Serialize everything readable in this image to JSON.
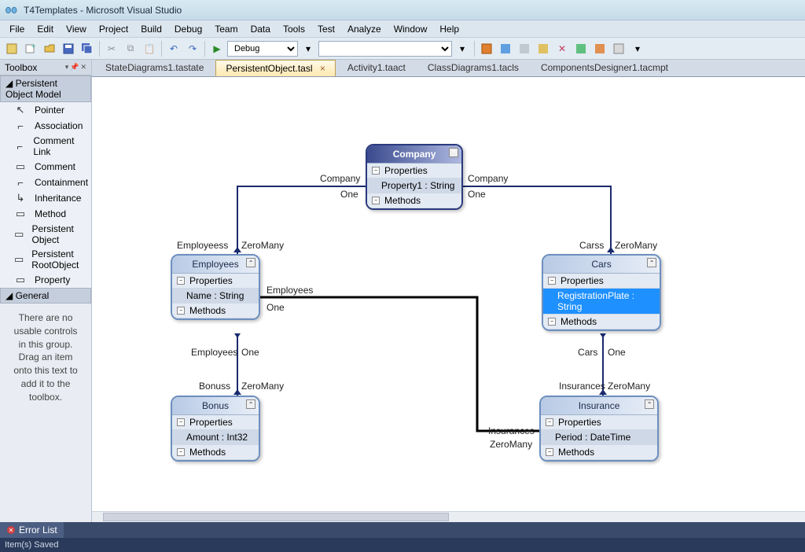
{
  "app": {
    "title": "T4Templates - Microsoft Visual Studio"
  },
  "menu": {
    "items": [
      "File",
      "Edit",
      "View",
      "Project",
      "Build",
      "Debug",
      "Team",
      "Data",
      "Tools",
      "Test",
      "Analyze",
      "Window",
      "Help"
    ]
  },
  "toolbar": {
    "config": "Debug"
  },
  "toolbox": {
    "title": "Toolbox",
    "section1": "Persistent Object Model",
    "items": [
      {
        "label": "Pointer",
        "icon": "↖"
      },
      {
        "label": "Association",
        "icon": "⌐"
      },
      {
        "label": "Comment Link",
        "icon": "⌐"
      },
      {
        "label": "Comment",
        "icon": "▭"
      },
      {
        "label": "Containment",
        "icon": "⌐"
      },
      {
        "label": "Inheritance",
        "icon": "↳"
      },
      {
        "label": "Method",
        "icon": "▭"
      },
      {
        "label": "Persistent Object",
        "icon": "▭"
      },
      {
        "label": "Persistent RootObject",
        "icon": "▭"
      },
      {
        "label": "Property",
        "icon": "▭"
      }
    ],
    "section2": "General",
    "empty": "There are no usable controls in this group. Drag an item onto this text to add it to the toolbox."
  },
  "tabs": [
    {
      "label": "StateDiagrams1.tastate",
      "active": false
    },
    {
      "label": "PersistentObject.tasl",
      "active": true
    },
    {
      "label": "Activity1.taact",
      "active": false
    },
    {
      "label": "ClassDiagrams1.tacls",
      "active": false
    },
    {
      "label": "ComponentsDesigner1.tacmpt",
      "active": false
    }
  ],
  "entities": {
    "company": {
      "name": "Company",
      "props_label": "Properties",
      "prop": "Property1 : String",
      "methods_label": "Methods"
    },
    "employees": {
      "name": "Employees",
      "props_label": "Properties",
      "prop": "Name : String",
      "methods_label": "Methods"
    },
    "cars": {
      "name": "Cars",
      "props_label": "Properties",
      "prop": "RegistrationPlate : String",
      "methods_label": "Methods"
    },
    "bonus": {
      "name": "Bonus",
      "props_label": "Properties",
      "prop": "Amount : Int32",
      "methods_label": "Methods"
    },
    "insurance": {
      "name": "Insurance",
      "props_label": "Properties",
      "prop": "Period : DateTime",
      "methods_label": "Methods"
    }
  },
  "labels": {
    "company_l": "Company",
    "one_l": "One",
    "company_r": "Company",
    "one_r": "One",
    "employeess": "Employeess",
    "zeromany": "ZeroMany",
    "carss": "Carss",
    "employees_assoc": "Employees",
    "one": "One",
    "employees_role": "Employees",
    "one2": "One",
    "bonuss": "Bonuss",
    "cars_role": "Cars",
    "one3": "One",
    "insurances": "Insurances",
    "insurances2": "Insurances",
    "zeromany2": "ZeroMany"
  },
  "statusTabs": {
    "errorList": "Error List"
  },
  "statusBar": {
    "msg": "Item(s) Saved"
  }
}
